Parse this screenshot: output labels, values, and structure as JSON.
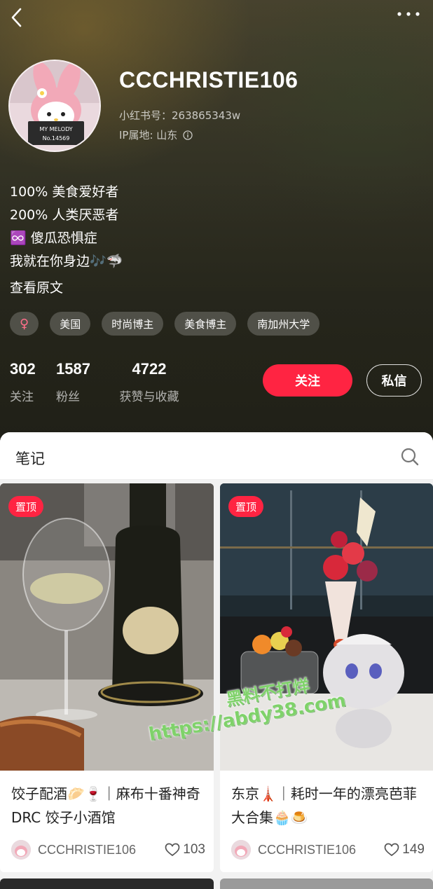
{
  "profile": {
    "username": "CCCHRISTIE106",
    "red_id": "小红书号：263865343w",
    "ip_location": "IP属地: 山东",
    "bio": [
      "100% 美食爱好者",
      "200% 人类厌恶者",
      "♾️ 傻瓜恐惧症",
      "我就在你身边🎶🦈"
    ],
    "view_original": "查看原文",
    "tags": [
      "♀",
      "美国",
      "时尚博主",
      "美食博主",
      "南加州大学"
    ],
    "stats": [
      {
        "value": "302",
        "label": "关注"
      },
      {
        "value": "1587",
        "label": "粉丝"
      },
      {
        "value": "4722",
        "label": "获赞与收藏"
      }
    ],
    "follow_label": "关注",
    "message_label": "私信",
    "avatar_text": "MY MELODY No.14569"
  },
  "notes": {
    "title": "笔记",
    "cards": [
      {
        "badge": "置顶",
        "title": "饺子配酒🥟🍷｜麻布十番神奇 DRC 饺子小酒馆",
        "author": "CCCHRISTIE106",
        "likes": "103"
      },
      {
        "badge": "置顶",
        "title": "东京🗼｜耗时一年的漂亮芭菲大合集🧁🍮",
        "author": "CCCHRISTIE106",
        "likes": "149"
      }
    ]
  },
  "watermark": {
    "line1": "黑料不打烊",
    "line2": "https://abdy38.com"
  },
  "colors": {
    "accent": "#ff2442",
    "header_bg": "#3b3a2a"
  },
  "icons": [
    "back-icon",
    "more-icon",
    "info-icon",
    "search-icon",
    "heart-icon"
  ]
}
